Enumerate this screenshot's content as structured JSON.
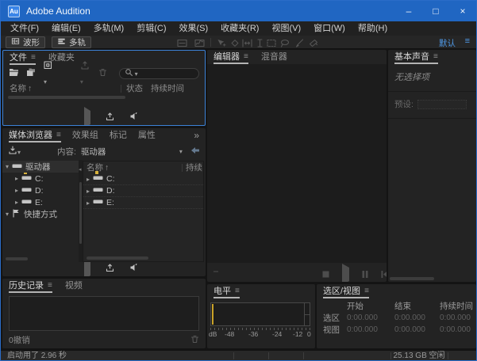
{
  "window": {
    "logo": "Au",
    "title": "Adobe Audition",
    "minimize": "–",
    "maximize": "□",
    "close": "×"
  },
  "menu": {
    "items": [
      "文件(F)",
      "编辑(E)",
      "多轨(M)",
      "剪辑(C)",
      "效果(S)",
      "收藏夹(R)",
      "视图(V)",
      "窗口(W)",
      "帮助(H)"
    ]
  },
  "toolbar": {
    "waveform": "波形",
    "multitrack": "多轨",
    "workspace": "默认",
    "workspace_menu": "≡"
  },
  "files": {
    "tab_files": "文件",
    "tab_favorites": "收藏夹",
    "panel_menu": "≡",
    "col_name": "名称",
    "sort_arrow": "↑",
    "col_status": "状态",
    "col_duration": "持续时间"
  },
  "media": {
    "tab_media": "媒体浏览器",
    "tab_effects": "效果组",
    "tab_markers": "标记",
    "tab_properties": "属性",
    "overflow": "»",
    "panel_menu": "≡",
    "content_label": "内容:",
    "content_value": "驱动器",
    "col_name": "名称",
    "sort_arrow": "↑",
    "col_duration": "持续",
    "tree": {
      "root": "驱动器",
      "shortcuts": "快捷方式"
    },
    "drives": [
      {
        "label": "C:"
      },
      {
        "label": "D:"
      },
      {
        "label": "E:"
      }
    ]
  },
  "history": {
    "tab_history": "历史记录",
    "tab_video": "视频",
    "panel_menu": "≡",
    "undo": "0撤销"
  },
  "editor": {
    "tab_editor": "编辑器",
    "tab_mixer": "混音器",
    "panel_menu": "≡"
  },
  "levels": {
    "tab": "电平",
    "panel_menu": "≡",
    "scale": [
      "dB",
      "-48",
      "-36",
      "-24",
      "-12",
      "0"
    ]
  },
  "selview": {
    "tab": "选区/视图",
    "panel_menu": "≡",
    "col_start": "开始",
    "col_end": "结束",
    "col_duration": "持续时间",
    "rows": [
      {
        "label": "选区",
        "start": "0:00.000",
        "end": "0:00.000",
        "duration": "0:00.000"
      },
      {
        "label": "视图",
        "start": "0:00.000",
        "end": "0:00.000",
        "duration": "0:00.000"
      }
    ]
  },
  "essential": {
    "tab": "基本声音",
    "panel_menu": "≡",
    "no_selection": "无选择项",
    "preset_label": "预设:"
  },
  "status": {
    "startup": "启动用了 2.96 秒",
    "disk_free": "25.13 GB 空闲"
  },
  "colors": {
    "titlebar": "#2066c2",
    "accent": "#4f9ae8",
    "focus_border": "#3c82d8",
    "peak": "#c9a227"
  }
}
